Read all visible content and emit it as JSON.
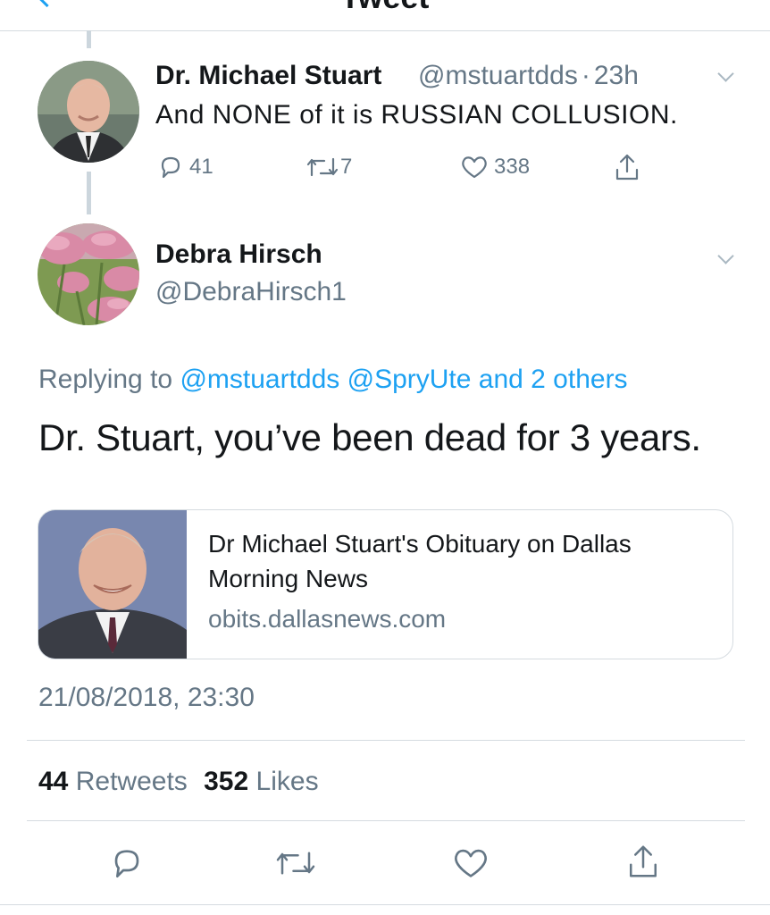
{
  "header": {
    "title": "Tweet"
  },
  "parent_tweet": {
    "name": "Dr. Michael Stuart",
    "handle": "@mstuartdds",
    "separator": "·",
    "time": "23h",
    "text": "And NONE of it is RUSSIAN COLLUSION.",
    "replies": "41",
    "retweets": "7",
    "likes": "338"
  },
  "main_tweet": {
    "name": "Debra Hirsch",
    "handle": "@DebraHirsch1",
    "replying_prefix": "Replying to",
    "replying_to": "@mstuartdds @SpryUte and 2 others",
    "text": "Dr. Stuart, you’ve been dead for 3 years.",
    "card": {
      "title": "Dr Michael Stuart's Obituary on Dallas Morning News",
      "domain": "obits.dallasnews.com"
    },
    "timestamp": "21/08/2018, 23:30",
    "retweet_count": "44",
    "retweet_label": "Retweets",
    "like_count": "352",
    "like_label": "Likes"
  },
  "icons": [
    "back-chevron-icon",
    "caret-down-icon",
    "reply-icon",
    "retweet-icon",
    "heart-icon",
    "share-icon"
  ],
  "colors": {
    "accent": "#1da1f2",
    "muted": "#657786",
    "text": "#14171a",
    "border": "#d5dbe0"
  }
}
